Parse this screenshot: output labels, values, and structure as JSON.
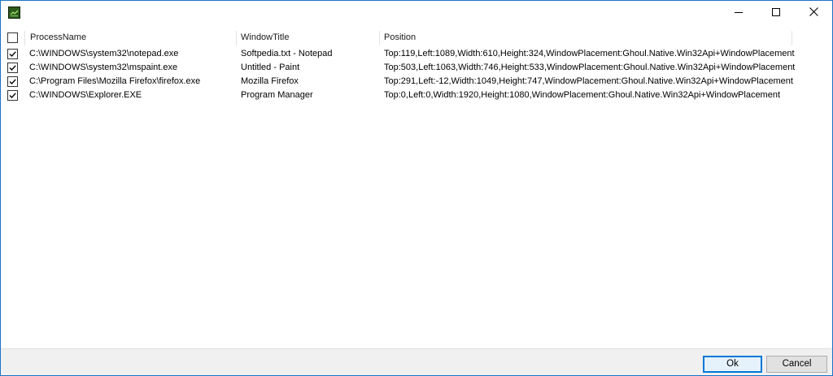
{
  "window": {
    "icon": "terminal-app-icon",
    "controls": {
      "minimize_icon": "minimize-icon",
      "maximize_icon": "maximize-icon",
      "close_icon": "close-icon"
    },
    "border_color": "#1a73c5"
  },
  "table": {
    "select_all_checked": false,
    "columns": [
      {
        "label": "ProcessName"
      },
      {
        "label": "WindowTitle"
      },
      {
        "label": "Position"
      }
    ],
    "rows": [
      {
        "checked": true,
        "process": "C:\\WINDOWS\\system32\\notepad.exe",
        "title": "Softpedia.txt - Notepad",
        "position": "Top:119,Left:1089,Width:610,Height:324,WindowPlacement:Ghoul.Native.Win32Api+WindowPlacement"
      },
      {
        "checked": true,
        "process": "C:\\WINDOWS\\system32\\mspaint.exe",
        "title": "Untitled - Paint",
        "position": "Top:503,Left:1063,Width:746,Height:533,WindowPlacement:Ghoul.Native.Win32Api+WindowPlacement"
      },
      {
        "checked": true,
        "process": "C:\\Program Files\\Mozilla Firefox\\firefox.exe",
        "title": "Mozilla Firefox",
        "position": "Top:291,Left:-12,Width:1049,Height:747,WindowPlacement:Ghoul.Native.Win32Api+WindowPlacement"
      },
      {
        "checked": true,
        "process": "C:\\WINDOWS\\Explorer.EXE",
        "title": "Program Manager",
        "position": "Top:0,Left:0,Width:1920,Height:1080,WindowPlacement:Ghoul.Native.Win32Api+WindowPlacement"
      }
    ]
  },
  "footer": {
    "ok_label": "Ok",
    "cancel_label": "Cancel",
    "accent": "#0078d7"
  }
}
